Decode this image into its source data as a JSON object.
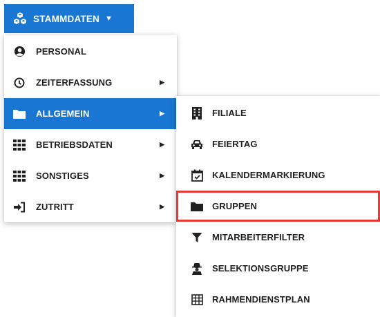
{
  "top_button": {
    "label": "STAMMDATEN",
    "icon": "cubes-icon",
    "caret": "▼"
  },
  "menu1": {
    "items": [
      {
        "label": "PERSONAL",
        "icon": "user-circle-icon",
        "submenu": false
      },
      {
        "label": "ZEITERFASSUNG",
        "icon": "clock-icon",
        "submenu": true
      },
      {
        "label": "ALLGEMEIN",
        "icon": "folder-icon",
        "submenu": true,
        "active": true
      },
      {
        "label": "BETRIEBSDATEN",
        "icon": "grid-icon",
        "submenu": true
      },
      {
        "label": "SONSTIGES",
        "icon": "grid-icon",
        "submenu": true
      },
      {
        "label": "ZUTRITT",
        "icon": "sign-in-icon",
        "submenu": true
      }
    ],
    "arrow": "▶"
  },
  "menu2": {
    "items": [
      {
        "label": "FILIALE",
        "icon": "building-icon"
      },
      {
        "label": "FEIERTAG",
        "icon": "car-icon"
      },
      {
        "label": "KALENDERMARKIERUNG",
        "icon": "calendar-check-icon"
      },
      {
        "label": "GRUPPEN",
        "icon": "folder-icon",
        "highlighted": true
      },
      {
        "label": "MITARBEITERFILTER",
        "icon": "filter-icon"
      },
      {
        "label": "SELEKTIONSGRUPPE",
        "icon": "user-secret-icon"
      },
      {
        "label": "RAHMENDIENSTPLAN",
        "icon": "table-icon"
      }
    ]
  },
  "colors": {
    "primary": "#1976d2",
    "highlight_border": "#e53935",
    "text": "#212121"
  }
}
